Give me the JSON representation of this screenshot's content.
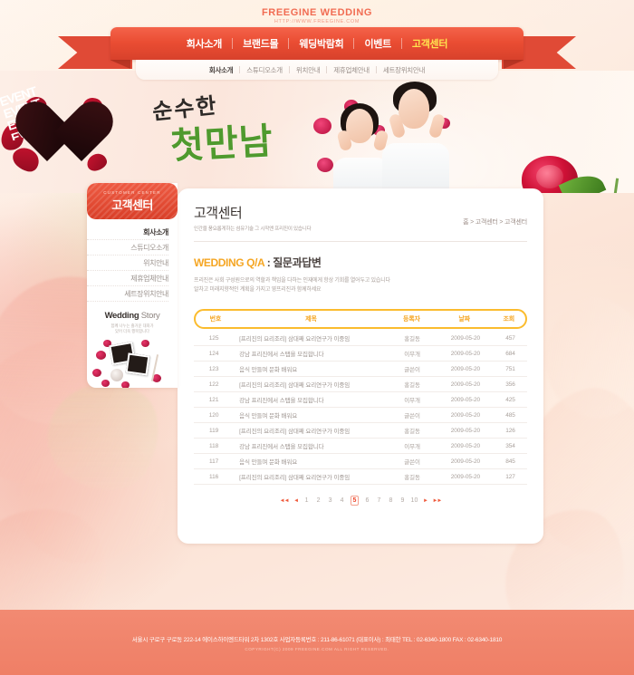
{
  "header": {
    "brand": "FREEGINE WEDDING",
    "url": "HTTP://WWW.FREEGINE.COM",
    "nav": [
      {
        "label": "회사소개",
        "active": false
      },
      {
        "label": "브랜드몰",
        "active": false
      },
      {
        "label": "웨딩박람회",
        "active": false
      },
      {
        "label": "이벤트",
        "active": false
      },
      {
        "label": "고객센터",
        "active": true
      }
    ],
    "subnav": [
      {
        "label": "회사소개",
        "active": true
      },
      {
        "label": "스튜디오소개",
        "active": false
      },
      {
        "label": "위치안내",
        "active": false
      },
      {
        "label": "제휴업체안내",
        "active": false
      },
      {
        "label": "세트장위치안내",
        "active": false
      }
    ]
  },
  "hero": {
    "event_badge": "EVENT",
    "calligraphy_top": "순수한",
    "calligraphy_main": "첫만남"
  },
  "sidebar": {
    "head_en": "CUSTOMER CENTER",
    "head_ko": "고객센터",
    "items": [
      {
        "label": "회사소개",
        "active": true
      },
      {
        "label": "스튜디오소개",
        "active": false
      },
      {
        "label": "위치안내",
        "active": false
      },
      {
        "label": "제휴업체안내",
        "active": false
      },
      {
        "label": "세트장위치안내",
        "active": false
      }
    ],
    "wedding_story": {
      "title_bold": "Wedding",
      "title_light": "Story",
      "desc_line1": "함께 나누는 즐거운 대화가",
      "desc_line2": "있어 더욱 행복합니다"
    }
  },
  "content": {
    "title": "고객센터",
    "subtitle": "인간을 풍요롭게하는 섬유기술 그 시작엔 프리진이 있습니다",
    "breadcrumb": "홈 > 고객센터 > 고객센터",
    "qa_title_en": "WEDDING Q/A",
    "qa_title_sep": " : ",
    "qa_title_ko": "질문과답변",
    "qa_desc_line1": "프리진은 사회 구성원으로의 역할과 책임을 다하는 인재에게 항상 기회를 열어두고 있습니다",
    "qa_desc_line2": "알차고 미래지향적인 계획을 가지고 영프리진과 함께하세요",
    "table": {
      "columns": [
        "번호",
        "제목",
        "등록자",
        "날짜",
        "조회"
      ],
      "rows": [
        {
          "no": "125",
          "title": "[프리진의 요리조리] 삼대째 요리연구가 이중임",
          "writer": "홍길동",
          "date": "2009-05-20",
          "hits": "457"
        },
        {
          "no": "124",
          "title": "강남 프리진에서 스탭을 모집합니다",
          "writer": "이무개",
          "date": "2009-05-20",
          "hits": "684"
        },
        {
          "no": "123",
          "title": "음식 만들며 문화 배워요",
          "writer": "글쓴이",
          "date": "2009-05-20",
          "hits": "751"
        },
        {
          "no": "122",
          "title": "[프리진의 요리조리] 삼대째 요리연구가 이중임",
          "writer": "홍길동",
          "date": "2009-05-20",
          "hits": "356"
        },
        {
          "no": "121",
          "title": "강남 프리진에서 스탭을 모집합니다",
          "writer": "이무개",
          "date": "2009-05-20",
          "hits": "425"
        },
        {
          "no": "120",
          "title": "음식 만들며 문화 배워요",
          "writer": "글쓴이",
          "date": "2009-05-20",
          "hits": "485"
        },
        {
          "no": "119",
          "title": "[프리진의 요리조리] 삼대째 요리연구가 이중임",
          "writer": "홍길동",
          "date": "2009-05-20",
          "hits": "126"
        },
        {
          "no": "118",
          "title": "강남 프리진에서 스탭을 모집합니다",
          "writer": "이무개",
          "date": "2009-05-20",
          "hits": "354"
        },
        {
          "no": "117",
          "title": "음식 만들며 문화 배워요",
          "writer": "글쓴이",
          "date": "2009-05-20",
          "hits": "845"
        },
        {
          "no": "116",
          "title": "[프리진의 요리조리] 삼대째 요리연구가 이중임",
          "writer": "홍길동",
          "date": "2009-05-20",
          "hits": "127"
        }
      ]
    },
    "pagination": {
      "first": "◄◄",
      "prev": "◄",
      "pages": [
        "1",
        "2",
        "3",
        "4",
        "5",
        "6",
        "7",
        "8",
        "9",
        "10"
      ],
      "current": "5",
      "next": "►",
      "last": "►►"
    }
  },
  "footer": {
    "address": "서울시 구로구 구로동 222-14 에이스하이엔드타워 2차 1302호  사업자등록번호 : 211-86-61071 (대표이사) : 최태한   TEL : 02-6340-1800   FAX : 02-6340-1810",
    "copyright": "COPYRIGHT(C) 2009 FREEGINE.COM ALL RIGHT RESERVED."
  },
  "colors": {
    "ribbon_red": "#ea4d33",
    "accent_yellow": "#ffe34f",
    "qa_orange": "#f5a623",
    "table_border": "#fbbc2e",
    "footer_pink": "#f28a72",
    "calligraphy_green": "#4f9a2e"
  }
}
